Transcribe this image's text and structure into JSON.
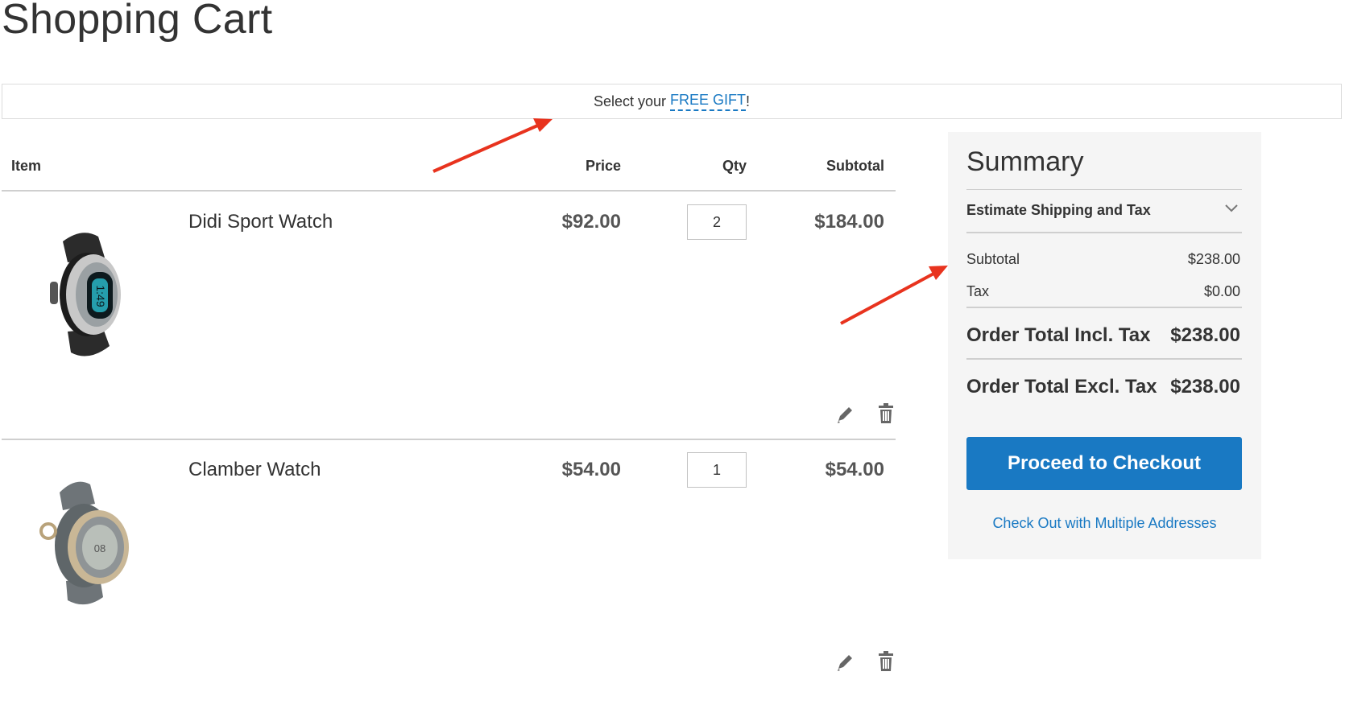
{
  "page": {
    "title": "Shopping Cart"
  },
  "gift_banner": {
    "prefix": "Select your",
    "link": "FREE GIFT",
    "suffix": "!"
  },
  "cart": {
    "columns": {
      "item": "Item",
      "price": "Price",
      "qty": "Qty",
      "subtotal": "Subtotal"
    },
    "items": [
      {
        "name": "Didi Sport Watch",
        "price": "$92.00",
        "qty": "2",
        "subtotal": "$184.00",
        "image": "sport-watch-black-silver"
      },
      {
        "name": "Clamber Watch",
        "price": "$54.00",
        "qty": "1",
        "subtotal": "$54.00",
        "image": "watch-gray-gold"
      }
    ],
    "actions": {
      "edit_icon": "pencil-icon",
      "remove_icon": "trash-icon"
    }
  },
  "summary": {
    "title": "Summary",
    "estimate_label": "Estimate Shipping and Tax",
    "subtotal_label": "Subtotal",
    "subtotal_value": "$238.00",
    "tax_label": "Tax",
    "tax_value": "$0.00",
    "total_incl_label": "Order Total Incl. Tax",
    "total_incl_value": "$238.00",
    "total_excl_label": "Order Total Excl. Tax",
    "total_excl_value": "$238.00",
    "checkout_label": "Proceed to Checkout",
    "multi_address_label": "Check Out with Multiple Addresses"
  },
  "colors": {
    "accent": "#1979c3",
    "annotation_arrow": "#e8331e",
    "summary_bg": "#f5f5f5"
  }
}
